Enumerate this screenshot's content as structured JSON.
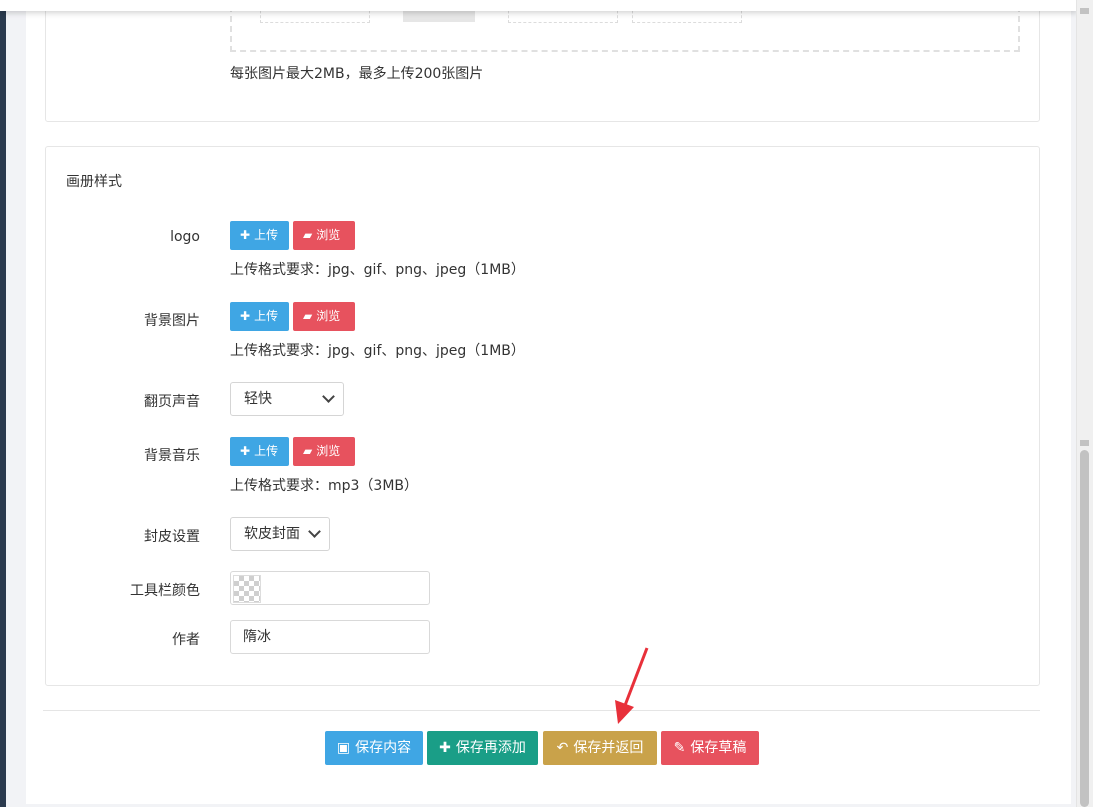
{
  "upload_section": {
    "hint": "每张图片最大2MB，最多上传200张图片"
  },
  "album_style": {
    "title": "画册样式",
    "logo": {
      "label": "logo",
      "upload_button": "上传",
      "browse_button": "浏览",
      "hint": "上传格式要求：jpg、gif、png、jpeg（1MB）"
    },
    "background_image": {
      "label": "背景图片",
      "upload_button": "上传",
      "browse_button": "浏览",
      "hint": "上传格式要求：jpg、gif、png、jpeg（1MB）"
    },
    "page_turn_sound": {
      "label": "翻页声音",
      "selected": "轻快"
    },
    "background_music": {
      "label": "背景音乐",
      "upload_button": "上传",
      "browse_button": "浏览",
      "hint": "上传格式要求：mp3（3MB）"
    },
    "cover_setting": {
      "label": "封皮设置",
      "selected": "软皮封面"
    },
    "toolbar_color": {
      "label": "工具栏颜色",
      "value": ""
    },
    "author": {
      "label": "作者",
      "value": "隋冰"
    }
  },
  "actions": {
    "save_content": "保存内容",
    "save_and_add": "保存再添加",
    "save_and_return": "保存并返回",
    "save_draft": "保存草稿"
  },
  "colors": {
    "upload": "#3fa6e4",
    "browse": "#e7525e",
    "save_content": "#3fa6e4",
    "save_and_add": "#1a9e87",
    "save_and_return": "#c9a24a",
    "save_draft": "#e7525e",
    "annotation_arrow": "#e8303a"
  },
  "icons": {
    "upload": "plus-icon",
    "browse": "folder-open-icon",
    "save_content": "floppy-disk-icon",
    "save_and_add": "plus-icon",
    "save_and_return": "reply-icon",
    "save_draft": "pencil-icon"
  }
}
